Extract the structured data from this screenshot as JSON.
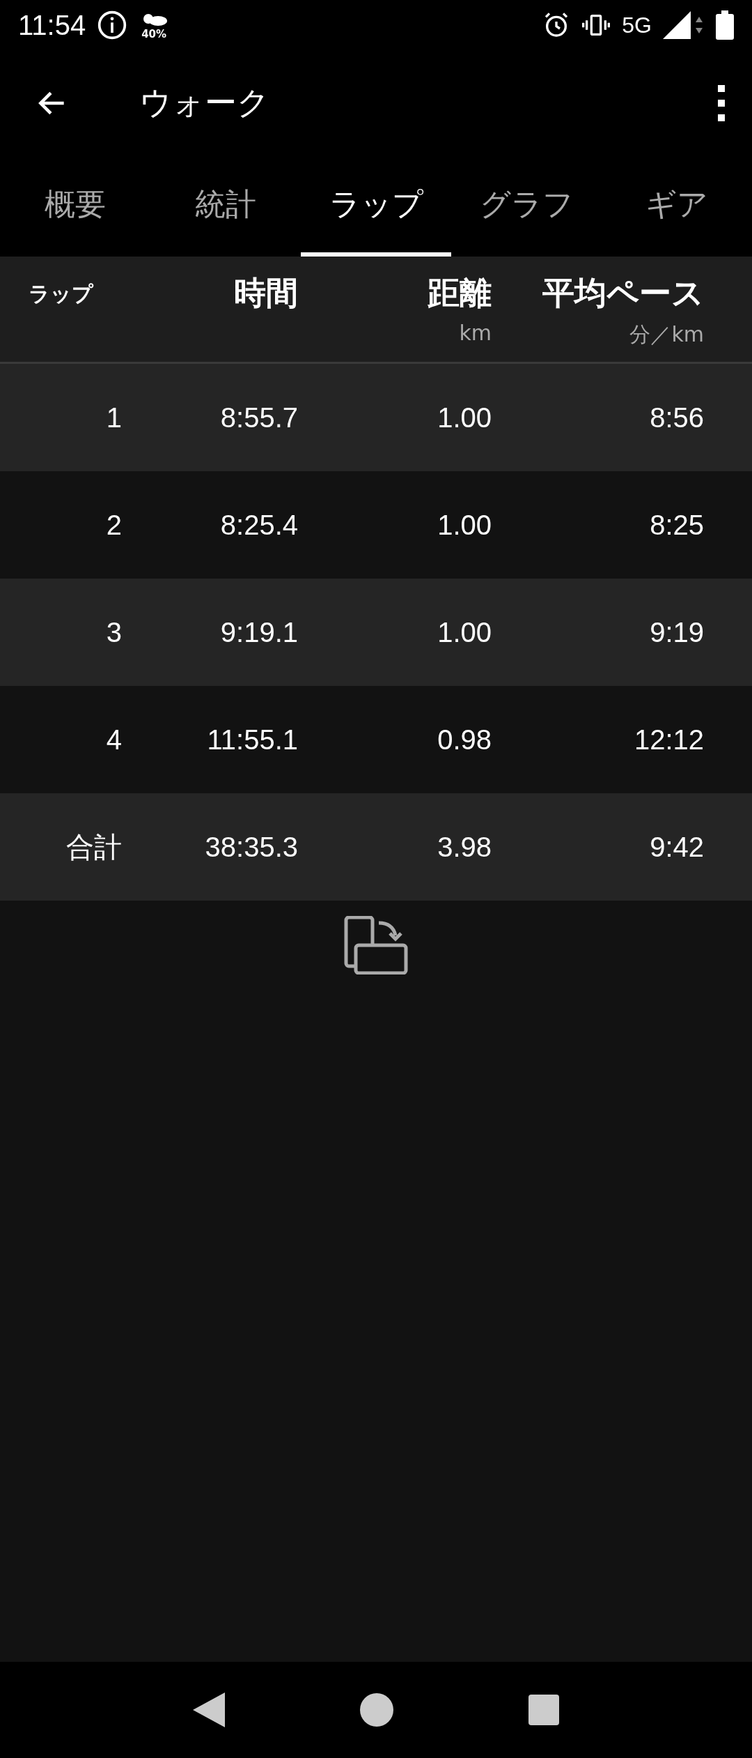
{
  "status_bar": {
    "time": "11:54",
    "weather": "40%",
    "network": "5G"
  },
  "app_bar": {
    "title": "ウォーク"
  },
  "tabs": [
    {
      "label": "概要",
      "selected": false
    },
    {
      "label": "統計",
      "selected": false
    },
    {
      "label": "ラップ",
      "selected": true
    },
    {
      "label": "グラフ",
      "selected": false
    },
    {
      "label": "ギア",
      "selected": false
    }
  ],
  "table": {
    "columns": [
      {
        "label": "ラップ"
      },
      {
        "label": "時間"
      },
      {
        "label": "距離",
        "unit": "km"
      },
      {
        "label": "平均ペース",
        "unit": "分／km"
      }
    ],
    "rows": [
      {
        "cells": [
          "1",
          "8:55.7",
          "1.00",
          "8:56"
        ]
      },
      {
        "cells": [
          "2",
          "8:25.4",
          "1.00",
          "8:25"
        ]
      },
      {
        "cells": [
          "3",
          "9:19.1",
          "1.00",
          "9:19"
        ]
      },
      {
        "cells": [
          "4",
          "11:55.1",
          "0.98",
          "12:12"
        ]
      },
      {
        "cells": [
          "合計",
          "38:35.3",
          "3.98",
          "9:42"
        ]
      }
    ]
  }
}
